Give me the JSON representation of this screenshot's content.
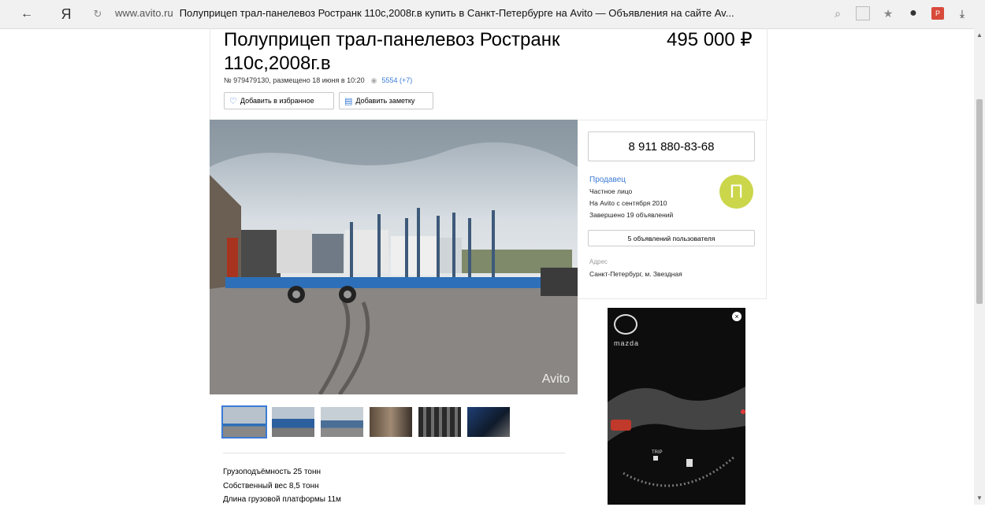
{
  "browser": {
    "back_icon": "←",
    "yandex_icon": "Я",
    "reload_icon": "↻",
    "host": "www.avito.ru",
    "page_title": "Полуприцеп трал-панелевоз Ространк 110с,2008г.в купить в Санкт-Петербурге на Avito — Объявления на сайте Av...",
    "icons": [
      "search-icon",
      "reader-icon",
      "star-icon",
      "extension-icon",
      "pdf-extension-icon",
      "download-icon"
    ]
  },
  "listing": {
    "title": "Полуприцеп трал-панелевоз Ространк 110с,2008г.в",
    "price": "495 000 ₽",
    "meta": "№ 979479130, размещено 18 июня в 10:20",
    "views": "5554 (+7)",
    "fav_label": "Добавить в избранное",
    "note_label": "Добавить заметку",
    "watermark": "Avito"
  },
  "description": [
    "Грузоподъёмность 25 тонн",
    "Собственный вес 8,5 тонн",
    "Длина грузовой платформы 11м"
  ],
  "seller": {
    "phone": "8 911 880-83-68",
    "label": "Продавец",
    "type": "Частное лицо",
    "since": "На Avito с сентября 2010",
    "completed": "Завершено 19 объявлений",
    "avatar_letter": "П",
    "user_items": "5 объявлений пользователя",
    "address_label": "Адрес",
    "address": "Санкт-Петербург, м. Звездная"
  },
  "ad": {
    "brand": "mazda",
    "trip_label": "TRIP",
    "close_icon": "×"
  },
  "colors": {
    "accent": "#3a7bd5",
    "avatar": "#cbd64b",
    "trailer": "#2d6fb8"
  }
}
